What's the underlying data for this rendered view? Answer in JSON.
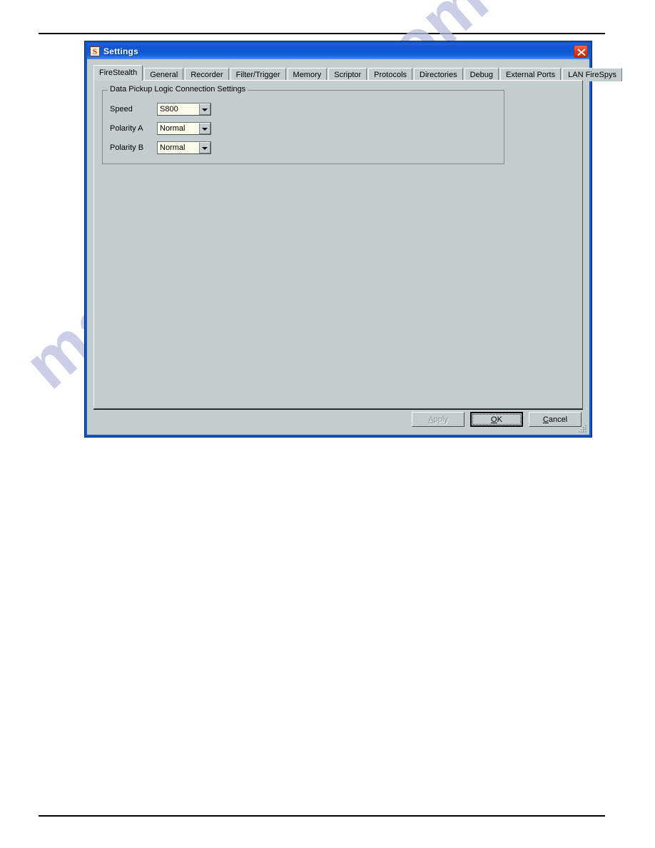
{
  "window": {
    "title": "Settings",
    "icon": "app-icon-s",
    "close_label": "×"
  },
  "tabs": [
    {
      "label": "FireStealth",
      "selected": true
    },
    {
      "label": "General",
      "selected": false
    },
    {
      "label": "Recorder",
      "selected": false
    },
    {
      "label": "Filter/Trigger",
      "selected": false
    },
    {
      "label": "Memory",
      "selected": false
    },
    {
      "label": "Scriptor",
      "selected": false
    },
    {
      "label": "Protocols",
      "selected": false
    },
    {
      "label": "Directories",
      "selected": false
    },
    {
      "label": "Debug",
      "selected": false
    },
    {
      "label": "External Ports",
      "selected": false
    },
    {
      "label": "LAN FireSpys",
      "selected": false
    }
  ],
  "groupbox": {
    "legend": "Data Pickup Logic Connection Settings",
    "fields": [
      {
        "label": "Speed",
        "value": "S800"
      },
      {
        "label": "Polarity A",
        "value": "Normal"
      },
      {
        "label": "Polarity B",
        "value": "Normal"
      }
    ]
  },
  "buttons": {
    "apply": {
      "label": "Apply",
      "accel": "A",
      "enabled": false,
      "default": false
    },
    "ok": {
      "label": "OK",
      "accel": "O",
      "enabled": true,
      "default": true
    },
    "cancel": {
      "label": "Cancel",
      "accel": "C",
      "enabled": true,
      "default": false
    }
  },
  "watermark": {
    "text": "manualshive.com"
  },
  "colors": {
    "dialog_face": "#C3CDD0",
    "titlebar_blue": "#0E5AD6",
    "close_red": "#D2400F",
    "combo_field": "#FBFBEC",
    "watermark": "#B9BEDE"
  }
}
